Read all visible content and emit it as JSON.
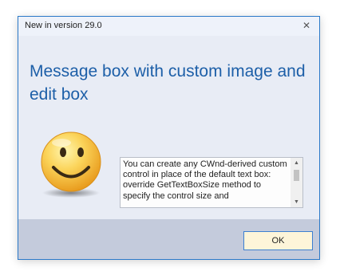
{
  "window": {
    "title": "New in version 29.0",
    "close_glyph": "✕"
  },
  "content": {
    "heading": "Message box with custom image and edit box",
    "image_icon": "smiley-face-icon",
    "edit_text": "You can create any CWnd-derived custom control in place of the default text box: override GetTextBoxSize method to specify the control size and",
    "scroll_up_glyph": "▲",
    "scroll_down_glyph": "▼"
  },
  "footer": {
    "ok_label": "OK"
  },
  "colors": {
    "heading": "#1d5fa8",
    "border": "#2b79c8",
    "footer_bg": "#c4cbdc",
    "button_bg": "#fdf5d9"
  }
}
